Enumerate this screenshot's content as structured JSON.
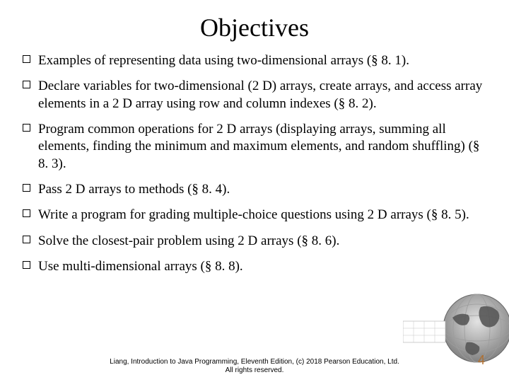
{
  "title": "Objectives",
  "bullets": [
    "Examples of representing data using two-dimensional arrays (§ 8. 1).",
    "Declare variables for two-dimensional (2 D) arrays, create arrays, and access array elements in a 2 D array using row and column indexes (§ 8. 2).",
    "Program common operations for 2 D arrays (displaying arrays, summing all elements, finding the minimum and maximum elements, and random shuffling) (§ 8. 3).",
    "Pass 2 D arrays to methods (§ 8. 4).",
    "Write a program for grading multiple-choice questions using 2 D arrays (§ 8. 5).",
    "Solve the closest-pair problem using 2 D arrays (§ 8. 6).",
    "Use multi-dimensional arrays (§ 8. 8)."
  ],
  "footer_line1": "Liang, Introduction to Java Programming, Eleventh Edition, (c) 2018 Pearson Education, Ltd.",
  "footer_line2": "All rights reserved.",
  "page_number": "4"
}
